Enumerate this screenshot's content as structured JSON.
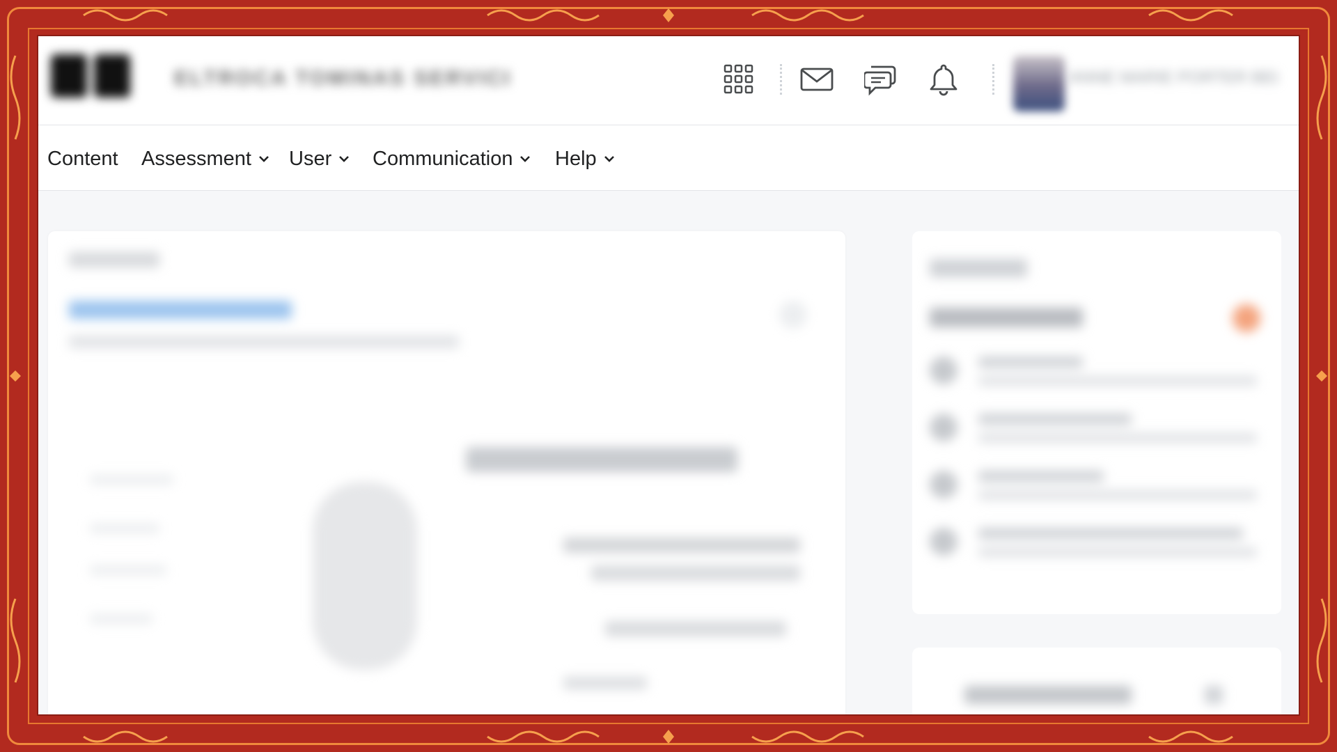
{
  "header": {
    "org_name": "ELTROCA TOMINAS SERVICE",
    "user_name": "ANNE MARIE PORTER BELL",
    "icons": [
      "apps-grid-icon",
      "mail-icon",
      "chat-icon",
      "bell-icon"
    ]
  },
  "nav": {
    "items": [
      {
        "label": "Content",
        "has_dropdown": false
      },
      {
        "label": "Assessment",
        "has_dropdown": true
      },
      {
        "label": "User",
        "has_dropdown": true
      },
      {
        "label": "Communication",
        "has_dropdown": true
      },
      {
        "label": "Help",
        "has_dropdown": true
      }
    ]
  },
  "colors": {
    "frame_red": "#b22a1f",
    "frame_orange": "#f08a3c",
    "link_blue": "#6aa6e8",
    "badge_orange": "#f47b42"
  }
}
